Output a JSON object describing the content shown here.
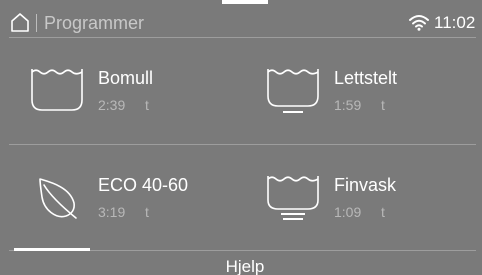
{
  "header": {
    "title": "Programmer",
    "clock": "11:02",
    "home_icon": "home-icon",
    "wifi_icon": "wifi-icon"
  },
  "programs": [
    {
      "name": "Bomull",
      "duration": "2:39",
      "unit": "t",
      "icon": "wash-tub-icon"
    },
    {
      "name": "Lettstelt",
      "duration": "1:59",
      "unit": "t",
      "icon": "wash-tub-single-bar-icon"
    },
    {
      "name": "ECO 40-60",
      "duration": "3:19",
      "unit": "t",
      "icon": "leaf-icon"
    },
    {
      "name": "Finvask",
      "duration": "1:09",
      "unit": "t",
      "icon": "wash-tub-double-bar-icon"
    }
  ],
  "footer": {
    "help_label": "Hjelp"
  },
  "colors": {
    "background": "#7a7a7a",
    "text": "#ffffff",
    "secondary_text": "#b8b8b8",
    "divider": "#9d9d9d"
  }
}
